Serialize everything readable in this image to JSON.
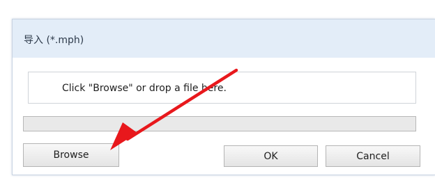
{
  "dialog": {
    "title": "导入 (*.mph)",
    "drop_text": "Click \"Browse\" or drop a file here.",
    "progress": 0,
    "buttons": {
      "browse_label": "Browse",
      "ok_label": "OK",
      "cancel_label": "Cancel"
    }
  },
  "annotation": {
    "arrow_color": "#e8181c",
    "arrow_target": "browse-button"
  }
}
